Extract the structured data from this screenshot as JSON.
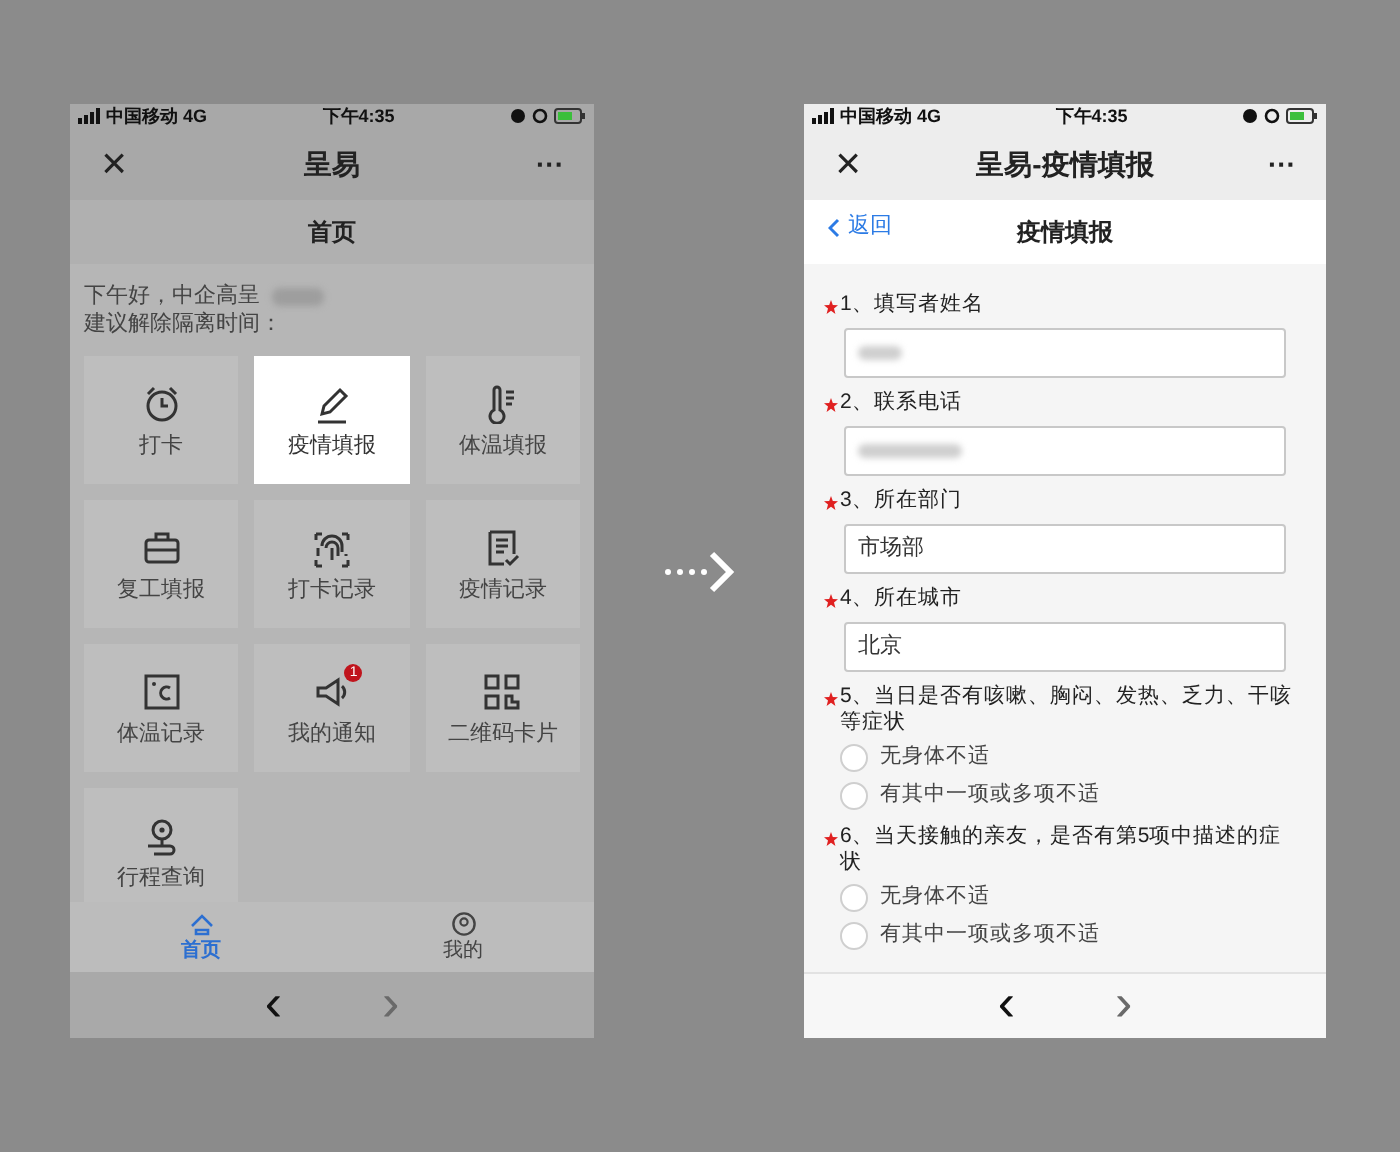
{
  "left_phone": {
    "status_bar": {
      "carrier": "中国移动 4G",
      "time": "下午4:35"
    },
    "nav_bar": {
      "close": "×",
      "title": "呈易",
      "more": "···"
    },
    "page_title": "首页",
    "greeting": "下午好，中企高呈",
    "greeting_note": "建议解除隔离时间：",
    "tiles": [
      {
        "label": "打卡",
        "highlighted": false
      },
      {
        "label": "疫情填报",
        "highlighted": true
      },
      {
        "label": "体温填报",
        "highlighted": false
      },
      {
        "label": "复工填报",
        "highlighted": false
      },
      {
        "label": "打卡记录",
        "highlighted": false
      },
      {
        "label": "疫情记录",
        "highlighted": false
      },
      {
        "label": "体温记录",
        "highlighted": false
      },
      {
        "label": "我的通知",
        "highlighted": false,
        "badge": "1"
      },
      {
        "label": "二维码卡片",
        "highlighted": false
      },
      {
        "label": "行程查询",
        "highlighted": false
      }
    ],
    "tab_bar": [
      {
        "label": "首页",
        "selected": true
      },
      {
        "label": "我的",
        "selected": false
      }
    ],
    "bottom_nav": {
      "back": "‹",
      "forward": "›"
    }
  },
  "right_phone": {
    "status_bar": {
      "carrier": "中国移动 4G",
      "time": "下午4:35"
    },
    "nav_bar": {
      "close": "×",
      "title": "呈易-疫情填报",
      "more": "···"
    },
    "header": {
      "back": "返回",
      "title": "疫情填报"
    },
    "questions": [
      {
        "kind": "blurred_text",
        "label": "1、填写者姓名"
      },
      {
        "kind": "blurred_text",
        "label": "2、联系电话"
      },
      {
        "kind": "text",
        "label": "3、所在部门",
        "value": "市场部"
      },
      {
        "kind": "text",
        "label": "4、所在城市",
        "value": "北京"
      },
      {
        "kind": "radio",
        "label": "5、当日是否有咳嗽、胸闷、发热、乏力、干咳等症状",
        "options": [
          {
            "label": "无身体不适",
            "selected": false
          },
          {
            "label": "有其中一项或多项不适",
            "selected": false
          }
        ]
      },
      {
        "kind": "radio",
        "label": "6、当天接触的亲友，是否有第5项中描述的症状",
        "options": [
          {
            "label": "无身体不适",
            "selected": false
          },
          {
            "label": "有其中一项或多项不适",
            "selected": false
          }
        ]
      }
    ],
    "bottom_nav": {
      "back": "‹",
      "forward": "›"
    }
  }
}
